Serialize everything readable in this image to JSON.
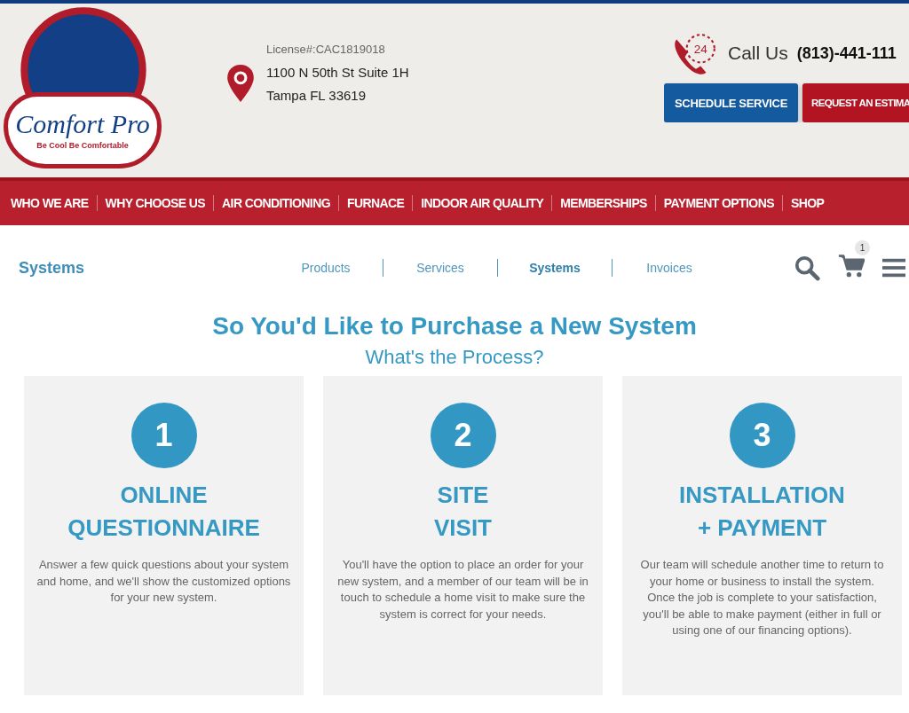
{
  "logo": {
    "title": "Comfort Pro",
    "tagline": "Be Cool Be Comfortable"
  },
  "header": {
    "license": "License#:CAC1819018",
    "address_line_1": "1100 N 50th St Suite 1H",
    "address_line_2": "Tampa FL 33619",
    "phone_icon_label": "24",
    "call_label": "Call Us",
    "phone": "(813)-441-111",
    "buttons": [
      {
        "label": "SCHEDULE SERVICE",
        "kind": "primary"
      },
      {
        "label": "REQUEST AN ESTIMA",
        "kind": "secondary"
      }
    ]
  },
  "main_nav": [
    "WHO WE ARE",
    "WHY CHOOSE US",
    "AIR CONDITIONING",
    "FURNACE",
    "INDOOR AIR QUALITY",
    "MEMBERSHIPS",
    "PAYMENT OPTIONS",
    "SHOP"
  ],
  "sub_nav": {
    "title": "Systems",
    "tabs": [
      {
        "label": "Products",
        "selected": false
      },
      {
        "label": "Services",
        "selected": false
      },
      {
        "label": "Systems",
        "selected": true
      },
      {
        "label": "Invoices",
        "selected": false
      }
    ],
    "cart_count": "1"
  },
  "heading": "So You'd Like to Purchase a New System",
  "subheading": "What's the Process?",
  "steps": [
    {
      "number": "1",
      "title_lines": [
        "ONLINE",
        "QUESTIONNAIRE"
      ],
      "text": "Answer a few quick questions about your system and home, and we'll show the customized options for your new system."
    },
    {
      "number": "2",
      "title_lines": [
        "SITE",
        "VISIT"
      ],
      "text": "You'll have the option to place an order for your new system, and a member of our team will be in touch to schedule a home visit to make sure the system is correct for your needs."
    },
    {
      "number": "3",
      "title_lines": [
        "INSTALLATION",
        "+ PAYMENT"
      ],
      "text": "Our team will schedule another time to return to your home or business to install the system. Once the job is complete to your satisfaction, you'll be able to make payment (either in full or using one of our financing options)."
    }
  ]
}
